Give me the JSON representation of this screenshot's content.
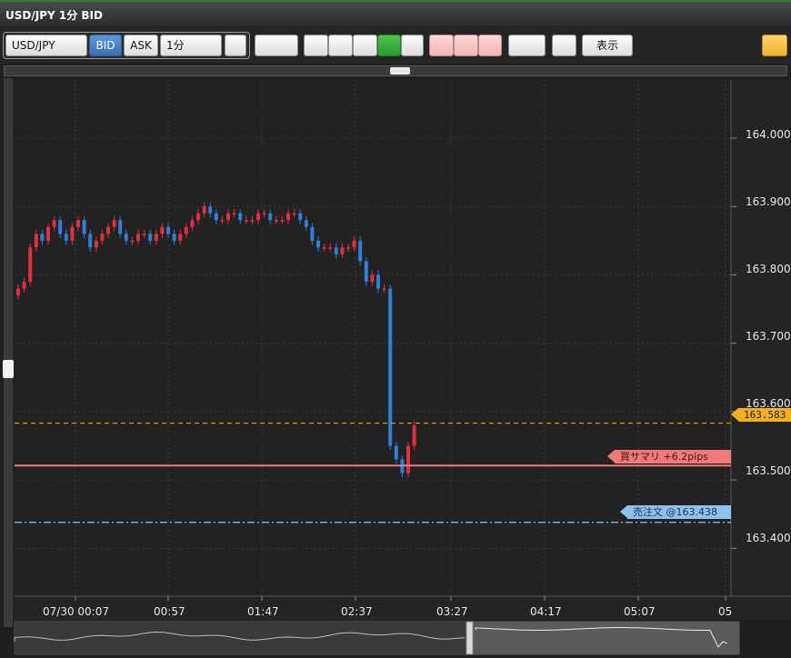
{
  "window": {
    "title": "USD/JPY 1分 BID"
  },
  "toolbar": {
    "symbol": "USD/JPY",
    "bid_label": "BID",
    "ask_label": "ASK",
    "timeframe": "1分",
    "show_label": "表示"
  },
  "colors": {
    "background": "#222222",
    "grid": "#3a3a3a",
    "candle_up": "#e03040",
    "candle_down": "#2f7fd6",
    "current_price": "#f1b01c",
    "buy_summary": "#f07a7a",
    "sell_order": "#8fc1ee"
  },
  "chart_data": {
    "type": "candlestick",
    "title": "USD/JPY 1分 BID",
    "y_ticks": [
      "164.000",
      "163.900",
      "163.800",
      "163.700",
      "163.600",
      "163.500",
      "163.400"
    ],
    "ylim": [
      163.33,
      164.085
    ],
    "x_ticks": [
      "07/30 00:07",
      "00:57",
      "01:47",
      "02:37",
      "03:27",
      "04:17",
      "05:07",
      "05"
    ],
    "series_close": [
      163.78,
      163.79,
      163.84,
      163.86,
      163.85,
      163.87,
      163.88,
      163.86,
      163.85,
      163.87,
      163.88,
      163.86,
      163.84,
      163.85,
      163.86,
      163.87,
      163.88,
      163.86,
      163.85,
      163.85,
      163.86,
      163.86,
      163.85,
      163.86,
      163.87,
      163.86,
      163.85,
      163.86,
      163.87,
      163.88,
      163.89,
      163.9,
      163.89,
      163.88,
      163.88,
      163.89,
      163.89,
      163.88,
      163.88,
      163.88,
      163.89,
      163.89,
      163.88,
      163.88,
      163.88,
      163.89,
      163.89,
      163.88,
      163.87,
      163.85,
      163.84,
      163.84,
      163.84,
      163.83,
      163.84,
      163.84,
      163.85,
      163.82,
      163.79,
      163.8,
      163.78,
      163.78,
      163.55,
      163.53,
      163.51,
      163.55,
      163.58
    ],
    "current_price": {
      "label": "163.583",
      "value": 163.583
    },
    "buy_summary": {
      "label": "買サマリ +6.2pips",
      "value": 163.521
    },
    "sell_order": {
      "label": "売注文 @163.438",
      "value": 163.438
    }
  }
}
